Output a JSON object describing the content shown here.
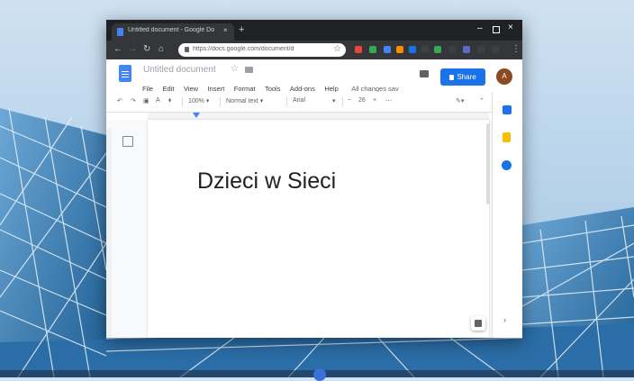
{
  "browser": {
    "tab_title": "Untitled document - Google Do",
    "tab_close": "×",
    "new_tab": "+",
    "url": "https://docs.google.com/document/d",
    "window_min": "–",
    "window_close": "×",
    "menu": "⋮"
  },
  "docs": {
    "title": "Untitled document",
    "menu": [
      "File",
      "Edit",
      "View",
      "Insert",
      "Format",
      "Tools",
      "Add-ons",
      "Help"
    ],
    "last_edit": "All changes sav",
    "share_label": "Share",
    "avatar_initial": "A"
  },
  "format_bar": {
    "zoom": "100%",
    "style": "Normal text",
    "font": "Arial",
    "font_size": "26"
  },
  "document": {
    "heading": "Dzieci w Sieci"
  },
  "colors": {
    "accent": "#1a73e8",
    "docs_blue": "#4285f4",
    "chrome_dark": "#202124",
    "avatar": "#8d4a22"
  },
  "icons": [
    "search-icon",
    "lock-icon",
    "star-icon",
    "folder-icon",
    "comments-icon",
    "calendar-icon",
    "keep-icon",
    "tasks-icon"
  ]
}
